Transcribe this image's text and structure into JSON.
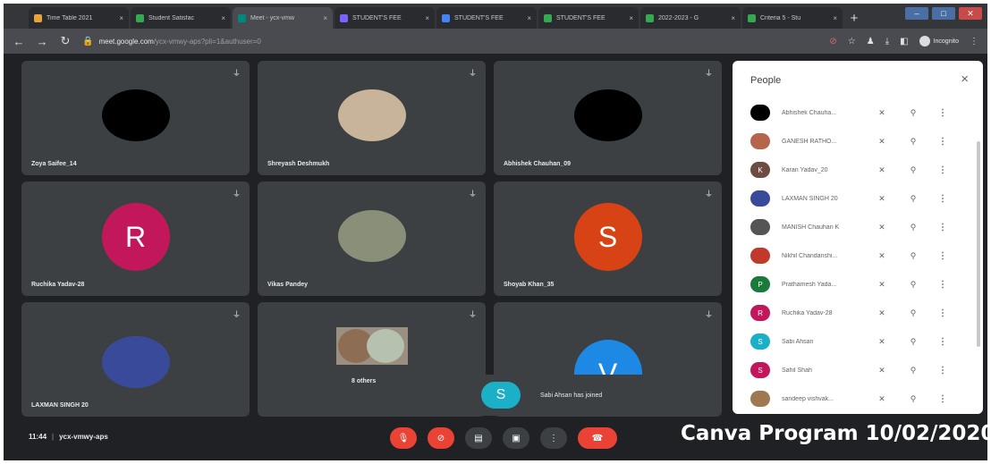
{
  "browser": {
    "tabs": [
      {
        "title": "Time Table 2021",
        "fav_color": "#e8a23a"
      },
      {
        "title": "Student Satisfac",
        "fav_color": "#34a853"
      },
      {
        "title": "Meet - ycx-vmw",
        "fav_color": "#00897b"
      },
      {
        "title": "STUDENT'S FEE",
        "fav_color": "#7b61ff"
      },
      {
        "title": "STUDENT'S FEE",
        "fav_color": "#4285f4"
      },
      {
        "title": "STUDENT'S FEE",
        "fav_color": "#34a853"
      },
      {
        "title": "2022-2023 - G",
        "fav_color": "#34a853"
      },
      {
        "title": "Criteria 5 - Stu",
        "fav_color": "#34a853"
      }
    ],
    "tab_close": "×",
    "new_tab": "+",
    "url_host": "meet.google.com",
    "url_path": "/ycx-vmwy-aps?pli=1&authuser=0",
    "incognito_label": "Incognito"
  },
  "tiles": [
    {
      "name": "Zoya Saifee_14",
      "type": "avatar",
      "color": "#000000"
    },
    {
      "name": "Shreyash Deshmukh",
      "type": "photo",
      "color": "#c8b49a"
    },
    {
      "name": "Abhishek Chauhan_09",
      "type": "avatar",
      "color": "#000000"
    },
    {
      "name": "Ruchika Yadav-28",
      "type": "initial",
      "initial": "R",
      "color": "#c2185b"
    },
    {
      "name": "Vikas Pandey",
      "type": "photo",
      "color": "#8a8f7a"
    },
    {
      "name": "Shoyab Khan_35",
      "type": "initial",
      "initial": "S",
      "color": "#d84315"
    },
    {
      "name": "LAXMAN SINGH 20",
      "type": "photo",
      "color": "#3a4a9a"
    },
    {
      "name": "8 others",
      "type": "group",
      "color": "#9a8f80"
    },
    {
      "name": "",
      "type": "initial",
      "initial": "V",
      "color": "#1e88e5"
    }
  ],
  "toast": {
    "initial": "S",
    "text": "Sabi Ahsan has joined",
    "color": "#1bb0c7"
  },
  "people": {
    "title": "People",
    "close": "×",
    "list": [
      {
        "name": "Abhishek Chauha...",
        "color": "#000000",
        "initial": ""
      },
      {
        "name": "GANESH RATHO...",
        "color": "#b5654a",
        "initial": ""
      },
      {
        "name": "Karan Yadav_20",
        "color": "#6d4c41",
        "initial": "K"
      },
      {
        "name": "LAXMAN SINGH 20",
        "color": "#3a4a9a",
        "initial": ""
      },
      {
        "name": "MANISH Chauhan K",
        "color": "#555555",
        "initial": ""
      },
      {
        "name": "Nikhil Chandanshi...",
        "color": "#c0392b",
        "initial": ""
      },
      {
        "name": "Prathamesh Yada...",
        "color": "#1b7a3a",
        "initial": "P"
      },
      {
        "name": "Ruchika Yadav-28",
        "color": "#c2185b",
        "initial": "R"
      },
      {
        "name": "Sabi Ahsan",
        "color": "#1bb0c7",
        "initial": "S"
      },
      {
        "name": "Sahil Shah",
        "color": "#c2185b",
        "initial": "S"
      },
      {
        "name": "sandeep vishvak...",
        "color": "#a07850",
        "initial": ""
      }
    ]
  },
  "bottom": {
    "time": "11:44",
    "meeting_code": "ycx-vmwy-aps",
    "caption": "Canva Program 10/02/2020"
  }
}
